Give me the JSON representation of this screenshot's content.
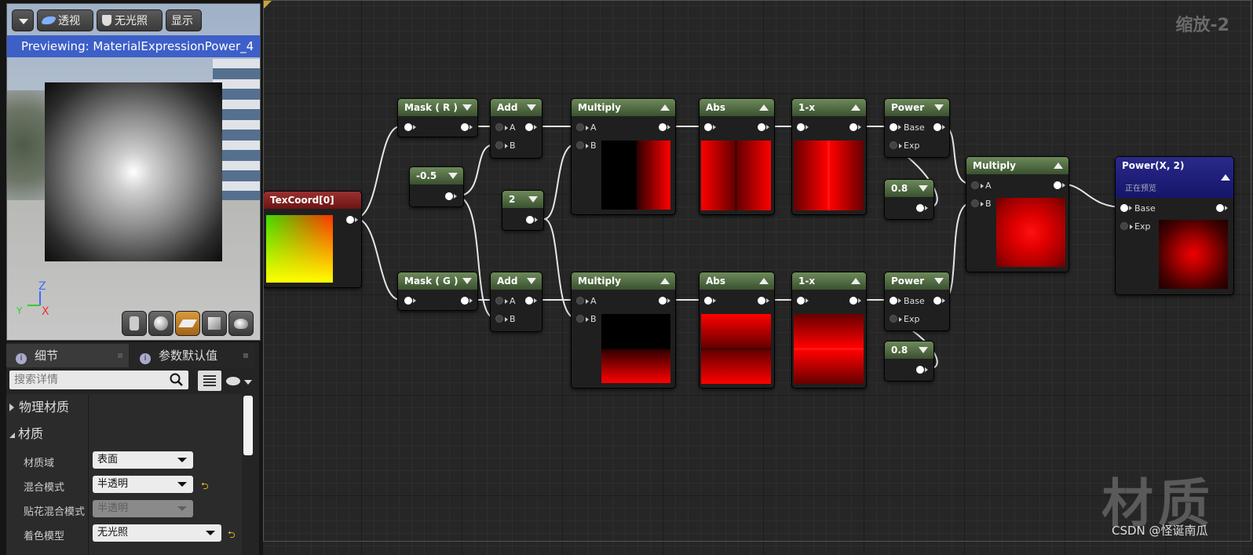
{
  "preview": {
    "dropdown_icon": "chevron-down-icon",
    "perspective_label": "透视",
    "unlit_label": "无光照",
    "show_label": "显示",
    "banner_text": "Previewing: MaterialExpressionPower_4",
    "axis_z": "Z",
    "axis_x": "X",
    "axis_y": "Y"
  },
  "details": {
    "tab_details": "细节",
    "tab_param_defaults": "参数默认值",
    "search_placeholder": "搜索详情",
    "cat_physical": "物理材质",
    "cat_material": "材质",
    "rows": [
      {
        "label": "材质域",
        "value": "表面",
        "disabled": false,
        "reset": false
      },
      {
        "label": "混合模式",
        "value": "半透明",
        "disabled": false,
        "reset": true
      },
      {
        "label": "贴花混合模式",
        "value": "半透明",
        "disabled": true,
        "reset": false
      },
      {
        "label": "着色模型",
        "value": "无光照",
        "disabled": false,
        "reset": true
      }
    ]
  },
  "graph": {
    "zoom_label": "缩放-2",
    "watermark": "材质",
    "csdn_credit": "CSDN @怪诞南瓜",
    "nodes": {
      "texcoord": {
        "title": "TexCoord[0]"
      },
      "mask_r": {
        "title": "Mask ( R )"
      },
      "mask_g": {
        "title": "Mask ( G )"
      },
      "const_neg05": {
        "title": "-0.5"
      },
      "const_2": {
        "title": "2"
      },
      "add_top": {
        "title": "Add",
        "pin_a": "A",
        "pin_b": "B"
      },
      "add_bot": {
        "title": "Add",
        "pin_a": "A",
        "pin_b": "B"
      },
      "mul_top": {
        "title": "Multiply",
        "pin_a": "A",
        "pin_b": "B"
      },
      "mul_bot": {
        "title": "Multiply",
        "pin_a": "A",
        "pin_b": "B"
      },
      "abs_top": {
        "title": "Abs"
      },
      "abs_bot": {
        "title": "Abs"
      },
      "onex_top": {
        "title": "1-x"
      },
      "onex_bot": {
        "title": "1-x"
      },
      "pow_top": {
        "title": "Power",
        "pin_base": "Base",
        "pin_exp": "Exp"
      },
      "pow_bot": {
        "title": "Power",
        "pin_base": "Base",
        "pin_exp": "Exp"
      },
      "const08_top": {
        "title": "0.8"
      },
      "const08_bot": {
        "title": "0.8"
      },
      "mul_final": {
        "title": "Multiply",
        "pin_a": "A",
        "pin_b": "B"
      },
      "result": {
        "title": "Power(X, 2)",
        "subtitle": "正在预览",
        "pin_base": "Base",
        "pin_exp": "Exp"
      }
    }
  }
}
